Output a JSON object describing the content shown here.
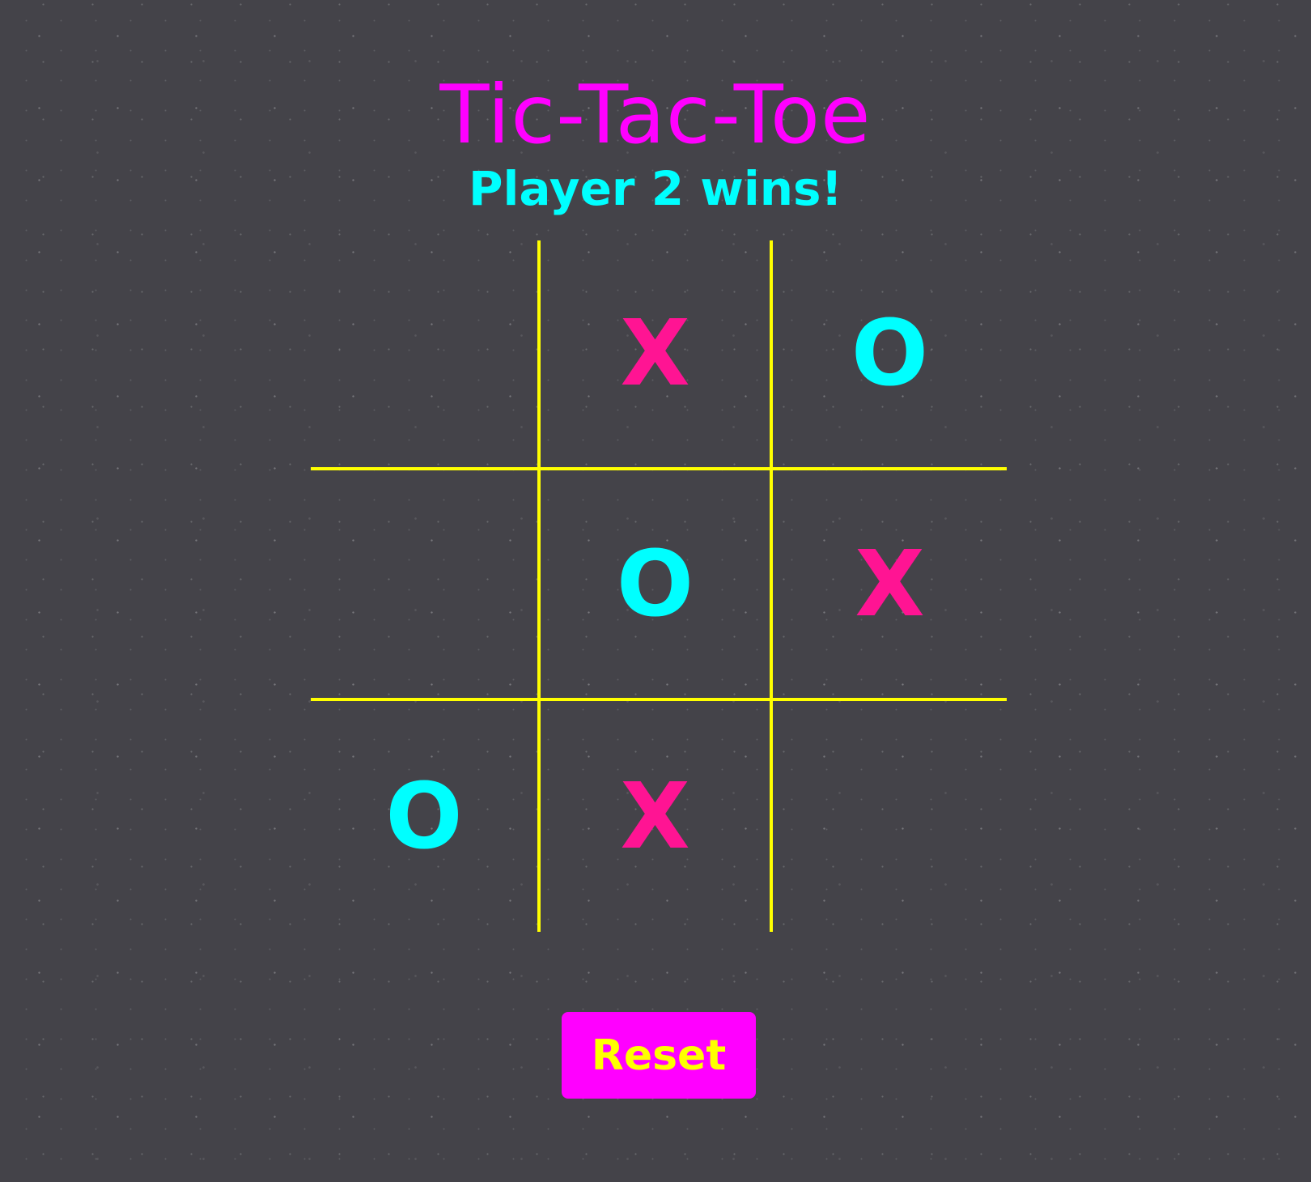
{
  "title": "Tic-Tac-Toe",
  "status": "Player 2 wins!",
  "reset_label": "Reset",
  "board": [
    [
      "",
      "X",
      "O"
    ],
    [
      "",
      "O",
      "X"
    ],
    [
      "O",
      "X",
      ""
    ]
  ],
  "colors": {
    "background": "#444349",
    "title": "#ff00ff",
    "status": "#00ffff",
    "grid_lines": "#ffff00",
    "x_mark": "#ff1493",
    "o_mark": "#00ffff",
    "reset_bg": "#ff00ff",
    "reset_text": "#ffff00"
  }
}
